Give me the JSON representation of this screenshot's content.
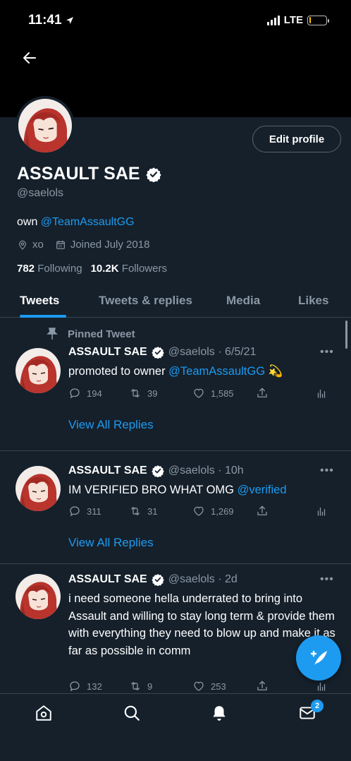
{
  "status_bar": {
    "time": "11:41",
    "network": "LTE",
    "battery_level": 0.12
  },
  "profile": {
    "display_name": "ASSAULT SAE",
    "handle": "@saelols",
    "bio_prefix": "own ",
    "bio_link": "@TeamAssaultGG",
    "location": "xo",
    "joined": "Joined July 2018",
    "following_count": "782",
    "following_label": "Following",
    "followers_count": "10.2K",
    "followers_label": "Followers",
    "edit_profile_label": "Edit profile"
  },
  "tabs": [
    {
      "label": "Tweets",
      "active": true
    },
    {
      "label": "Tweets & replies",
      "active": false
    },
    {
      "label": "Media",
      "active": false
    },
    {
      "label": "Likes",
      "active": false
    }
  ],
  "pinned_label": "Pinned Tweet",
  "tweets": [
    {
      "name": "ASSAULT SAE",
      "meta": "@saelols · 6/5/21",
      "text": "promoted to owner ",
      "text_link": "@TeamAssaultGG",
      "text_suffix": " 💫",
      "replies": "194",
      "retweets": "39",
      "likes": "1,585",
      "view_replies": "View All Replies"
    },
    {
      "name": "ASSAULT SAE",
      "meta": "@saelols · 10h",
      "text": "IM VERIFIED BRO WHAT OMG ",
      "text_link": "@verified",
      "text_suffix": "",
      "replies": "311",
      "retweets": "31",
      "likes": "1,269",
      "view_replies": "View All Replies"
    },
    {
      "name": "ASSAULT SAE",
      "meta": "@saelols · 2d",
      "text": "i need someone hella underrated to bring into Assault and willing to stay long term & provide them with everything they need to blow up and make it as far as possible in comm",
      "text_link": "",
      "text_suffix": "",
      "replies": "132",
      "retweets": "9",
      "likes": "253"
    }
  ],
  "nav": {
    "messages_badge": "2"
  },
  "colors": {
    "background": "#15202b",
    "accent": "#1d9bf0",
    "muted": "#8b98a5",
    "divider": "#38444d"
  },
  "icons": [
    "back-arrow-icon",
    "verified-badge-icon",
    "location-icon",
    "calendar-icon",
    "pin-icon",
    "reply-icon",
    "retweet-icon",
    "like-icon",
    "share-icon",
    "analytics-icon",
    "compose-icon",
    "home-icon",
    "search-icon",
    "notifications-icon",
    "messages-icon"
  ]
}
